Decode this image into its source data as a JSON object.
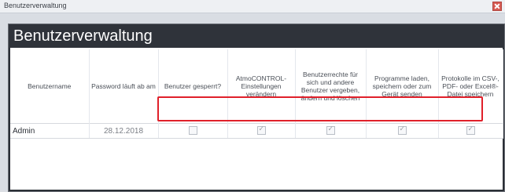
{
  "window": {
    "title": "Benutzerverwaltung"
  },
  "panel": {
    "title": "Benutzerverwaltung"
  },
  "table": {
    "columns": [
      "Benutzername",
      "Password läuft ab am",
      "Benutzer gesperrt?",
      "AtmoCONTROL-Einstellungen verändern",
      "Benutzerrechte für sich und andere Benutzer vergeben, ändern und löschen",
      "Programme laden, speichern oder zum Gerät senden",
      "Protokolle im CSV-, PDF- oder Excel®-Datei speichern"
    ],
    "rows": [
      {
        "username": "Admin",
        "password_expires": "28.12.2018",
        "locked": false,
        "settings": true,
        "rights": true,
        "programs": true,
        "protocols": true
      }
    ]
  },
  "accent": {
    "highlight": "#e0202a",
    "header_bg": "#2f333a"
  }
}
